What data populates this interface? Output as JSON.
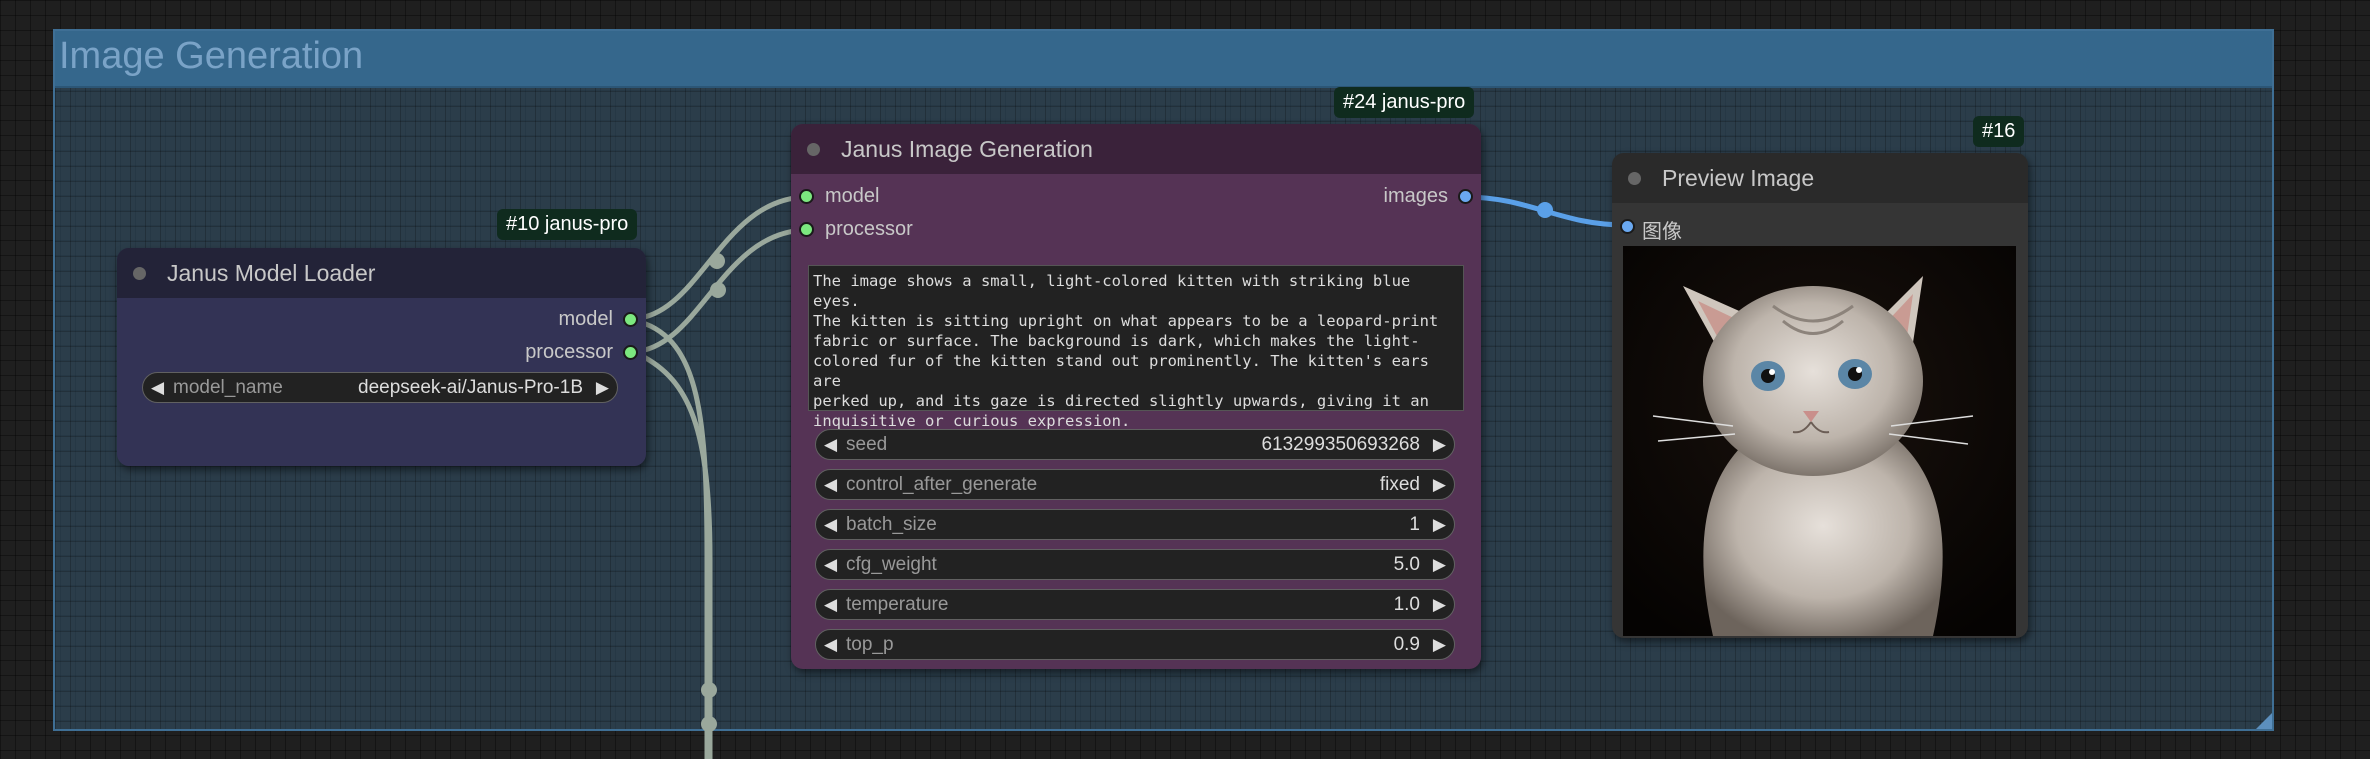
{
  "group": {
    "title": "Image Generation"
  },
  "nodes": {
    "loader": {
      "badge": "#10 janus-pro",
      "title": "Janus Model Loader",
      "outputs": [
        "model",
        "processor"
      ],
      "widget": {
        "name": "model_name",
        "value": "deepseek-ai/Janus-Pro-1B"
      }
    },
    "generation": {
      "badge": "#24 janus-pro",
      "title": "Janus Image Generation",
      "inputs": [
        "model",
        "processor"
      ],
      "output": "images",
      "prompt": "The image shows a small, light-colored kitten with striking blue eyes.\nThe kitten is sitting upright on what appears to be a leopard-print\nfabric or surface. The background is dark, which makes the light-\ncolored fur of the kitten stand out prominently. The kitten's ears are\nperked up, and its gaze is directed slightly upwards, giving it an\ninquisitive or curious expression.",
      "widgets": [
        {
          "name": "seed",
          "value": "613299350693268"
        },
        {
          "name": "control_after_generate",
          "value": "fixed"
        },
        {
          "name": "batch_size",
          "value": "1"
        },
        {
          "name": "cfg_weight",
          "value": "5.0"
        },
        {
          "name": "temperature",
          "value": "1.0"
        },
        {
          "name": "top_p",
          "value": "0.9"
        }
      ]
    },
    "preview": {
      "badge": "#16",
      "title": "Preview Image",
      "input": "图像"
    }
  },
  "icons": {
    "arrow_left": "◀",
    "arrow_right": "▶"
  },
  "colors": {
    "group_header": "#35678c",
    "generation_node": "#553355",
    "loader_node": "#333355",
    "model_slot": "#7ce87f",
    "image_slot": "#6aa8f0"
  }
}
